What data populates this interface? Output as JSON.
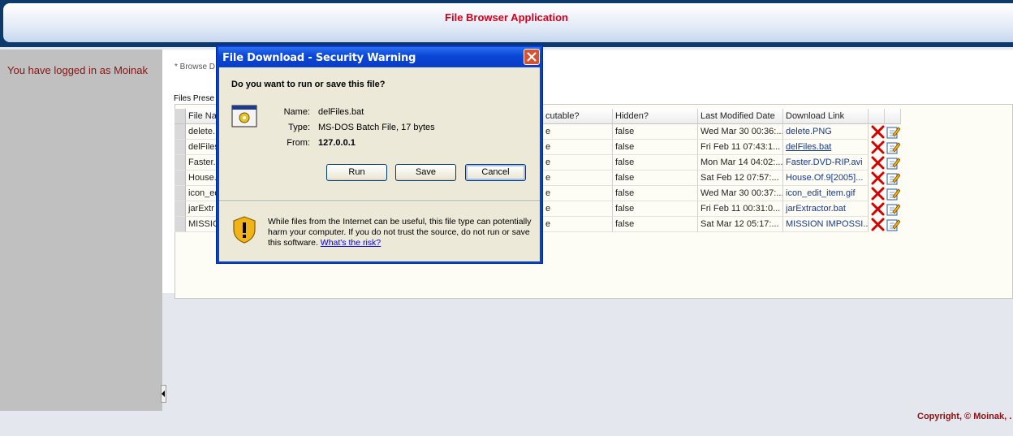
{
  "header": {
    "title": "File Browser Application"
  },
  "sidebar": {
    "login_text": "You have logged in as Moinak"
  },
  "main": {
    "browse_text": "* Browse D",
    "files_label": "Files Prese",
    "columns": [
      "File Na",
      "cutable?",
      "Hidden?",
      "Last Modified Date",
      "Download Link"
    ],
    "rows": [
      {
        "name": "delete.",
        "exec": "e",
        "hidden": "false",
        "modified": "Wed Mar 30 00:36:...",
        "link": "delete.PNG"
      },
      {
        "name": "delFiles",
        "exec": "e",
        "hidden": "false",
        "modified": "Fri Feb 11 07:43:1...",
        "link": "delFiles.bat"
      },
      {
        "name": "Faster.",
        "exec": "e",
        "hidden": "false",
        "modified": "Mon Mar 14 04:02:...",
        "link": "Faster.DVD-RIP.avi"
      },
      {
        "name": "House.",
        "exec": "e",
        "hidden": "false",
        "modified": "Sat Feb 12 07:57:...",
        "link": "House.Of.9[2005]..."
      },
      {
        "name": "icon_ed",
        "exec": "e",
        "hidden": "false",
        "modified": "Wed Mar 30 00:37:...",
        "link": "icon_edit_item.gif"
      },
      {
        "name": "jarExtr",
        "exec": "e",
        "hidden": "false",
        "modified": "Fri Feb 11 00:31:0...",
        "link": "jarExtractor.bat"
      },
      {
        "name": "MISSIO",
        "exec": "e",
        "hidden": "false",
        "modified": "Sat Mar 12 05:17:...",
        "link": "MISSION IMPOSSI..."
      }
    ]
  },
  "footer": {
    "copyright": "Copyright, © Moinak, ."
  },
  "dialog": {
    "title": "File Download - Security Warning",
    "question": "Do you want to run or save this file?",
    "name_label": "Name:",
    "name_value": "delFiles.bat",
    "type_label": "Type:",
    "type_value": "MS-DOS Batch File, 17 bytes",
    "from_label": "From:",
    "from_value": "127.0.0.1",
    "run_label": "Run",
    "save_label": "Save",
    "cancel_label": "Cancel",
    "warning_text": "While files from the Internet can be useful, this file type can potentially harm your computer. If you do not trust the source, do not run or save this software.",
    "risk_link": "What's the risk?"
  },
  "colors": {
    "accent": "#d3001c",
    "login": "#8b1010",
    "titlebar": "#0a46d6"
  },
  "icons": {
    "delete": "delete-x-icon",
    "edit": "edit-pencil-icon",
    "close": "close-icon",
    "warning": "shield-warning-icon",
    "file": "batch-file-icon"
  }
}
